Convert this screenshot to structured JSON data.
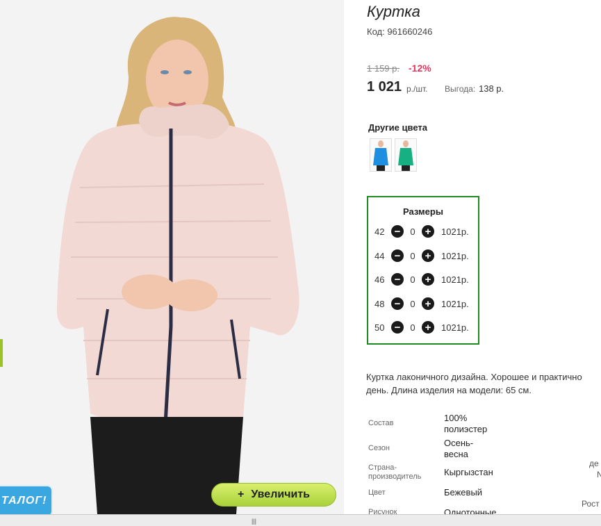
{
  "product": {
    "title": "Куртка",
    "code": "Код: 961660246",
    "old_price": "1 159 р.",
    "discount": "-12%",
    "price": "1 021",
    "price_unit": "р./шт.",
    "saving_label": "Выгода:",
    "saving_value": "138 р."
  },
  "photo": {
    "zoom_label": "Увеличить",
    "zoom_icon": "+",
    "catalog_badge": "ТАЛОГ!"
  },
  "other_colors": {
    "title": "Другие цвета",
    "swatches": [
      {
        "name": "blue",
        "color": "#1e8fe0"
      },
      {
        "name": "turquoise",
        "color": "#16b083"
      }
    ]
  },
  "sizes": {
    "title": "Размеры",
    "rows": [
      {
        "size": "42",
        "qty": "0",
        "price": "1021р."
      },
      {
        "size": "44",
        "qty": "0",
        "price": "1021р."
      },
      {
        "size": "46",
        "qty": "0",
        "price": "1021р."
      },
      {
        "size": "48",
        "qty": "0",
        "price": "1021р."
      },
      {
        "size": "50",
        "qty": "0",
        "price": "1021р."
      }
    ]
  },
  "description": {
    "line1": "Куртка лаконичного дизайна. Хорошее и практично",
    "line2": "день. Длина изделия на модели: 65 см."
  },
  "attributes": [
    {
      "label": "Состав",
      "value1": "100%",
      "value2": "полиэстер"
    },
    {
      "label": "Сезон",
      "value1": "Осень-",
      "value2": "весна"
    },
    {
      "label": "Страна-",
      "label2": "производитель",
      "value1": "Кыргызстан"
    },
    {
      "label": "Цвет",
      "value1": "Бежевый"
    },
    {
      "label": "Рисунок",
      "value1": "Однотонные"
    }
  ],
  "edge": {
    "text1": "де",
    "text2": "N",
    "text3": "Рост"
  },
  "colors": {
    "accent_green": "#1f8a1f",
    "discount_red": "#e0365d",
    "catalog_blue": "#3aa7e0",
    "zoom_lime": "#c4e14f"
  }
}
